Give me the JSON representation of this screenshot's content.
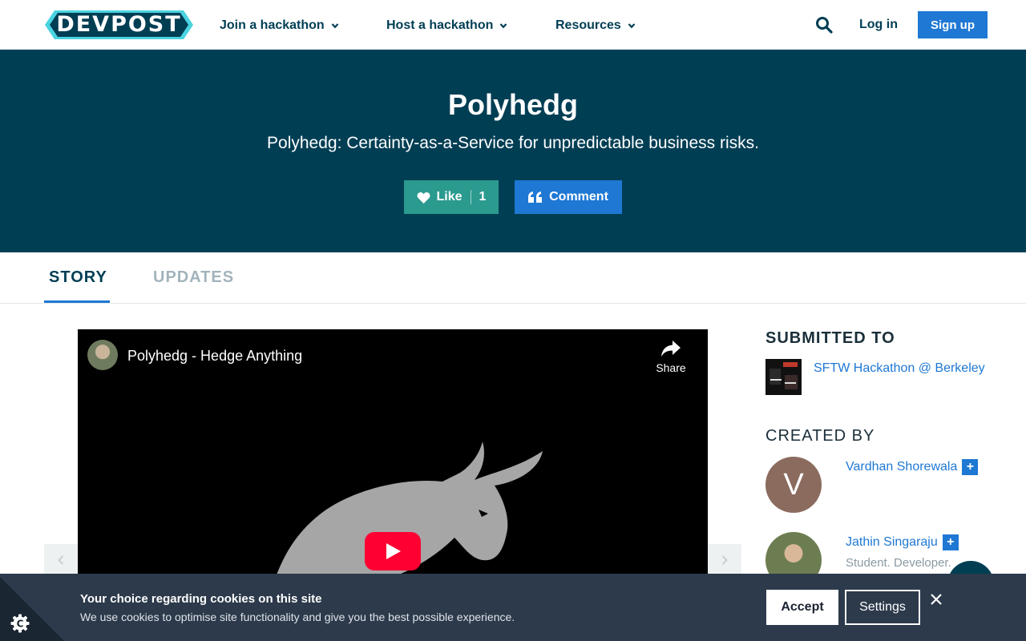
{
  "header": {
    "logo_text": "DEVPOST",
    "nav": [
      {
        "label": "Join a hackathon"
      },
      {
        "label": "Host a hackathon"
      },
      {
        "label": "Resources"
      }
    ],
    "login_label": "Log in",
    "signup_label": "Sign up"
  },
  "hero": {
    "title": "Polyhedg",
    "subtitle": "Polyhedg: Certainty-as-a-Service for unpredictable business risks.",
    "like_label": "Like",
    "like_count": "1",
    "comment_label": "Comment"
  },
  "tabs": [
    {
      "label": "STORY",
      "active": true
    },
    {
      "label": "UPDATES",
      "active": false
    }
  ],
  "video": {
    "title": "Polyhedg - Hedge Anything",
    "share_label": "Share",
    "prev_icon": "chevron-left-icon",
    "next_icon": "chevron-right-icon"
  },
  "sidebar": {
    "submitted_heading": "SUBMITTED TO",
    "hackathon_name": "SFTW Hackathon @ Berkeley",
    "created_heading": "CREATED BY",
    "members": [
      {
        "name": "Vardhan Shorewala",
        "initial": "V",
        "bio": ""
      },
      {
        "name": "Jathin Singaraju",
        "initial": "",
        "bio": "Student. Developer."
      }
    ],
    "follow_symbol": "+"
  },
  "cookie": {
    "title": "Your choice regarding cookies on this site",
    "text": "We use cookies to optimise site functionality and give you the best possible experience.",
    "accept_label": "Accept",
    "settings_label": "Settings"
  },
  "colors": {
    "brand_dark": "#003e54",
    "link_blue": "#1e78d4",
    "like_teal": "#2b9a8f",
    "cookie_bg": "#2c3a4b",
    "logo_cyan": "#4ad3e0"
  }
}
